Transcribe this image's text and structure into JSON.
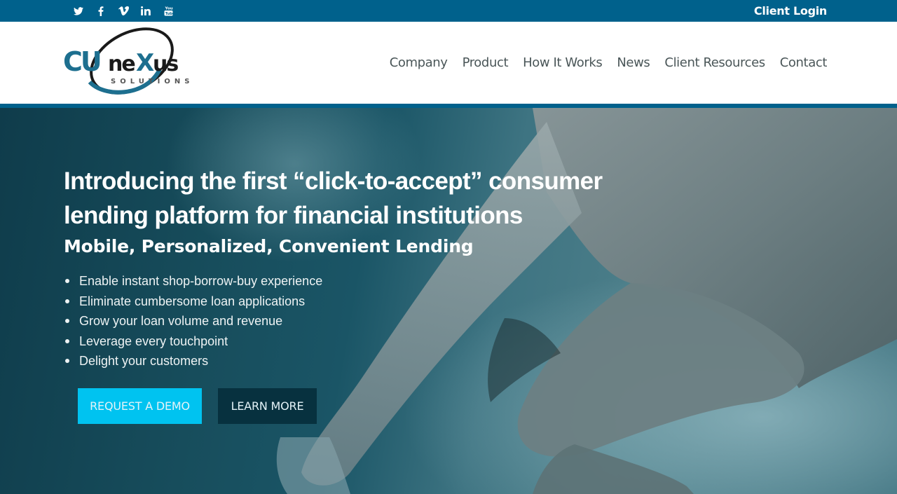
{
  "topbar": {
    "social": [
      {
        "name": "twitter",
        "icon": "twitter-icon"
      },
      {
        "name": "facebook",
        "icon": "facebook-icon"
      },
      {
        "name": "vimeo",
        "icon": "vimeo-icon"
      },
      {
        "name": "linkedin",
        "icon": "linkedin-icon"
      },
      {
        "name": "youtube",
        "icon": "youtube-icon"
      }
    ],
    "client_login": "Client Login"
  },
  "header": {
    "logo": {
      "primary": "CUneXus",
      "tag": "SOLUTIONS"
    },
    "nav": [
      {
        "label": "Company"
      },
      {
        "label": "Product"
      },
      {
        "label": "How It Works"
      },
      {
        "label": "News"
      },
      {
        "label": "Client Resources"
      },
      {
        "label": "Contact"
      }
    ]
  },
  "hero": {
    "headline_line1": "Introducing the first “click-to-accept” consumer",
    "headline_line2": "lending platform for financial institutions",
    "subhead": "Mobile, Personalized, Convenient Lending",
    "bullets": [
      "Enable instant shop-borrow-buy experience",
      "Eliminate cumbersome loan applications",
      "Grow your loan volume and revenue",
      "Leverage every touchpoint",
      "Delight your customers"
    ],
    "buttons": {
      "request_demo": "REQUEST A DEMO",
      "learn_more": "LEARN MORE"
    }
  },
  "colors": {
    "brand_blue": "#00618c",
    "demo_button": "#00c3f0",
    "learn_button": "#07313f",
    "nav_text": "#4a5658",
    "logo_dark": "#1a1a1a",
    "logo_blue": "#1d6f8f"
  }
}
